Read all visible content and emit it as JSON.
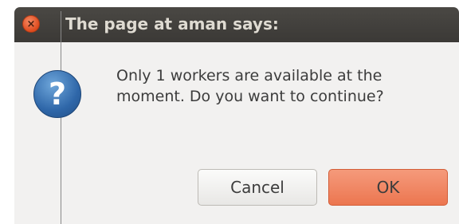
{
  "dialog": {
    "title": "The page at aman says:",
    "close_icon": "close-icon",
    "message_lines": [
      "Only 1 workers are available at the",
      "moment. Do you want to continue?"
    ],
    "icon": "question-icon",
    "buttons": {
      "cancel_label": "Cancel",
      "ok_label": "OK"
    }
  },
  "colors": {
    "titlebar": "#3b3936",
    "close_button": "#de4a1d",
    "ok_button": "#ec7650",
    "body_background": "#f2f1f0"
  }
}
